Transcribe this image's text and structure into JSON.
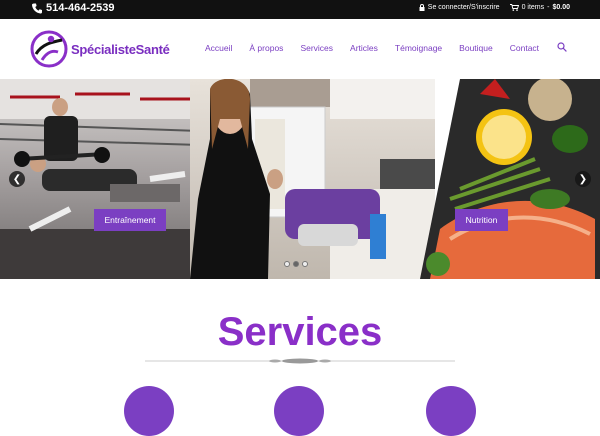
{
  "topbar": {
    "phone": "514-464-2539",
    "login": "Se connecter/S'inscrire",
    "cart_items": "0 items",
    "cart_sep": "-",
    "cart_total": "$0.00"
  },
  "header": {
    "logo_part1": "Spécialiste",
    "logo_part2": "Santé",
    "nav": [
      "Accueil",
      "À propos",
      "Services",
      "Articles",
      "Témoignage",
      "Boutique",
      "Contact"
    ]
  },
  "hero": {
    "caption_left": "Entraînement",
    "caption_right": "Nutrition",
    "slides": 3,
    "active_slide": 2
  },
  "services": {
    "title": "Services"
  },
  "colors": {
    "brand": "#7b3fc2",
    "title": "#8a2fc8",
    "topbar": "#111111"
  }
}
